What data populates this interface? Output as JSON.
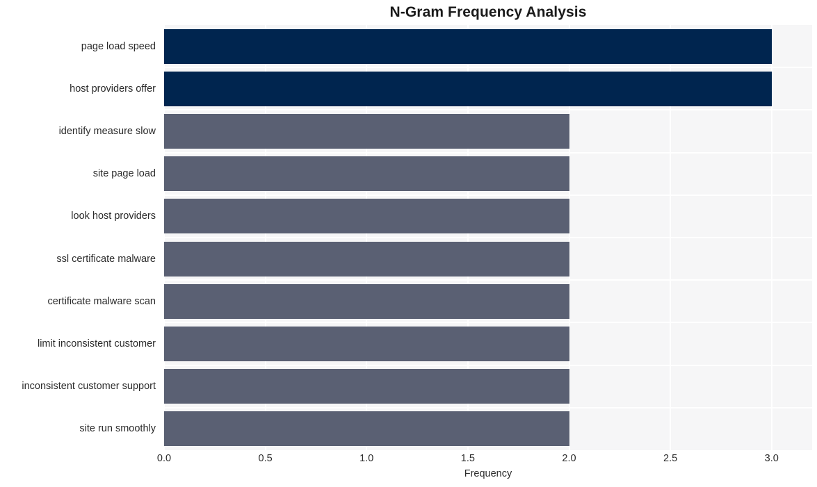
{
  "chart_data": {
    "type": "bar",
    "orientation": "horizontal",
    "title": "N-Gram Frequency Analysis",
    "xlabel": "Frequency",
    "ylabel": "",
    "categories": [
      "page load speed",
      "host providers offer",
      "identify measure slow",
      "site page load",
      "look host providers",
      "ssl certificate malware",
      "certificate malware scan",
      "limit inconsistent customer",
      "inconsistent customer support",
      "site run smoothly"
    ],
    "values": [
      3,
      3,
      2,
      2,
      2,
      2,
      2,
      2,
      2,
      2
    ],
    "bar_colors": [
      "#00254f",
      "#00254f",
      "#5a6073",
      "#5a6073",
      "#5a6073",
      "#5a6073",
      "#5a6073",
      "#5a6073",
      "#5a6073",
      "#5a6073"
    ],
    "xlim": [
      0,
      3.2
    ],
    "xticks": [
      0,
      0.5,
      1,
      1.5,
      2,
      2.5,
      3
    ],
    "xtick_labels": [
      "0.0",
      "0.5",
      "1.0",
      "1.5",
      "2.0",
      "2.5",
      "3.0"
    ],
    "grid": true,
    "grid_color": "#ffffff",
    "plot_background": "#f6f6f7",
    "figure_background": "#ffffff",
    "legend": null
  }
}
